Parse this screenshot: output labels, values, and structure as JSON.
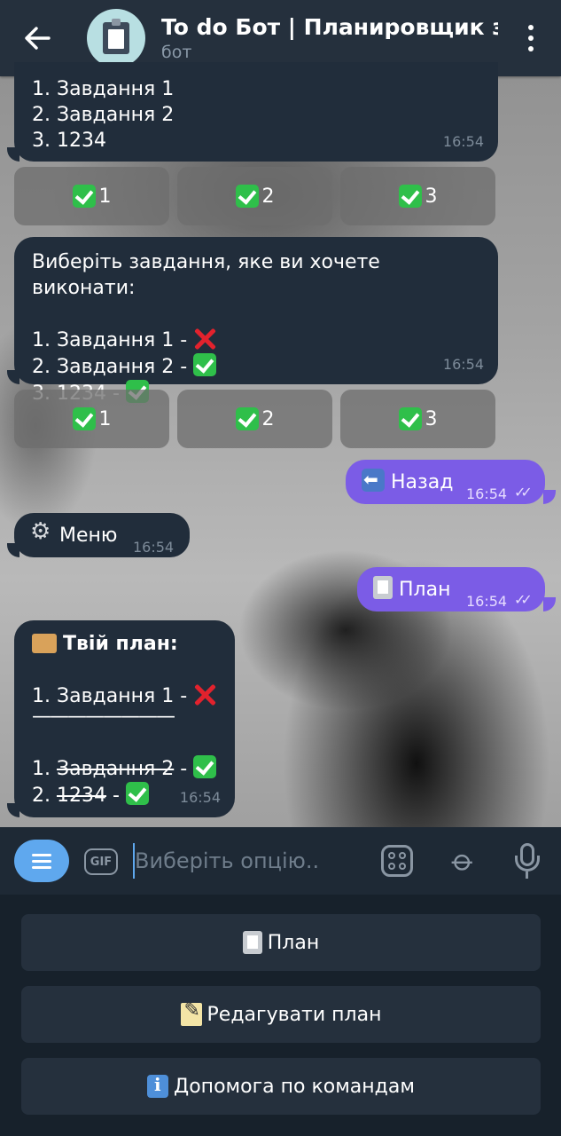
{
  "header": {
    "title": "To do Бот | Планировщик задач",
    "subtitle": "бот"
  },
  "messages": {
    "m1": {
      "lines": [
        "1. Завдання 1",
        "2. Завдання 2",
        "3. 1234"
      ],
      "time": "16:54"
    },
    "kb1": [
      "1",
      "2",
      "3"
    ],
    "m2": {
      "title": "Виберіть завдання, яке ви хочете виконати:",
      "items": [
        "1. Завдання 1 - ",
        "2. Завдання 2 - ",
        "3. 1234 - "
      ],
      "time": "16:54"
    },
    "kb2": [
      "1",
      "2",
      "3"
    ],
    "out1": {
      "text": "Назад",
      "time": "16:54"
    },
    "in1": {
      "text": "Меню",
      "time": "16:54"
    },
    "out2": {
      "text": "План",
      "time": "16:54"
    },
    "m3": {
      "title": "Твій план:",
      "line1": "1. Завдання 1 - ",
      "divider": "————————",
      "done_num1": "1. ",
      "done_text1": "Завдання 2",
      "done_num2": "2. ",
      "done_text2": "1234",
      "dash": " - ",
      "time": "16:54"
    }
  },
  "input": {
    "placeholder": "Виберіть опцію..",
    "gif_label": "GIF"
  },
  "reply_keyboard": {
    "plan": "План",
    "edit": "Редагувати план",
    "help": "Допомога по командам"
  },
  "colors": {
    "outgoing": "#7b5ce6",
    "incoming": "#212d3b",
    "accent": "#5fa8ee"
  }
}
